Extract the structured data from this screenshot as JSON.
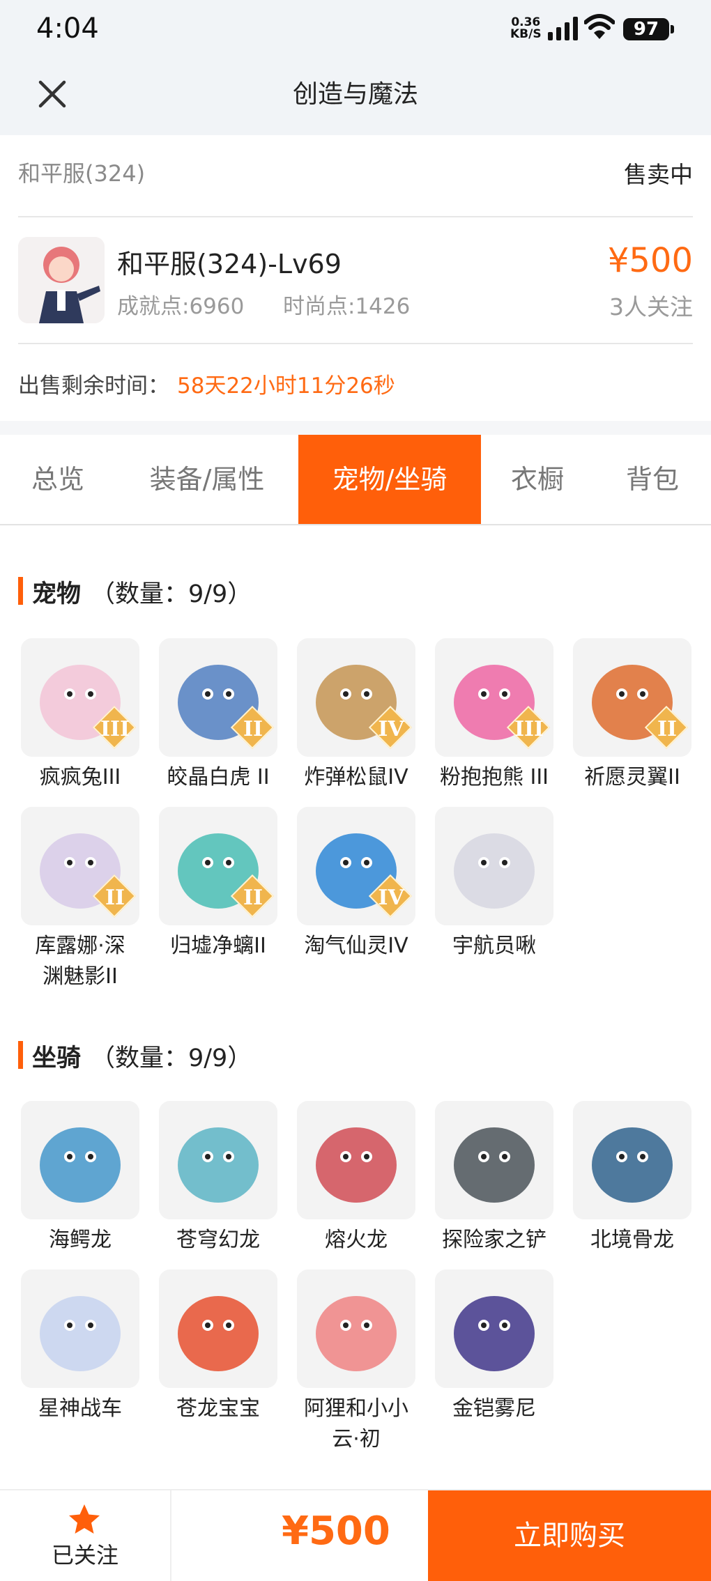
{
  "status_bar": {
    "time": "4:04",
    "net_speed_top": "0.36",
    "net_speed_bottom": "KB/S",
    "battery": "97"
  },
  "nav": {
    "title": "创造与魔法"
  },
  "listing": {
    "server": "和平服(324)",
    "status": "售卖中",
    "character_title": "和平服(324)-Lv69",
    "achievement": "成就点:6960",
    "fashion": "时尚点:1426",
    "price": "¥500",
    "followers": "3人关注",
    "remaining_label": "出售剩余时间：",
    "remaining_value": "58天22小时11分26秒"
  },
  "tabs": [
    {
      "label": "总览",
      "active": false
    },
    {
      "label": "装备/属性",
      "active": false
    },
    {
      "label": "宠物/坐骑",
      "active": true
    },
    {
      "label": "衣橱",
      "active": false
    },
    {
      "label": "背包",
      "active": false
    }
  ],
  "pets": {
    "title": "宠物",
    "count": "（数量：9/9）",
    "items": [
      {
        "name": "疯疯兔III",
        "rank": "III",
        "color": "#f3c6d8"
      },
      {
        "name": "皎晶白虎 II",
        "rank": "II",
        "color": "#5b86c4"
      },
      {
        "name": "炸弹松鼠IV",
        "rank": "IV",
        "color": "#c89a5c"
      },
      {
        "name": "粉抱抱熊 III",
        "rank": "III",
        "color": "#ee6fa9"
      },
      {
        "name": "祈愿灵翼II",
        "rank": "II",
        "color": "#e0743a"
      },
      {
        "name": "库露娜·深\n渊魅影II",
        "rank": "II",
        "color": "#d9cde9"
      },
      {
        "name": "归墟净螭II",
        "rank": "II",
        "color": "#53c1b8"
      },
      {
        "name": "淘气仙灵IV",
        "rank": "IV",
        "color": "#3a8ed8"
      },
      {
        "name": "宇航员啾",
        "rank": "",
        "color": "#d8d8e2"
      }
    ]
  },
  "mounts": {
    "title": "坐骑",
    "count": "（数量：9/9）",
    "items": [
      {
        "name": "海鳄龙",
        "color": "#4f9ccd"
      },
      {
        "name": "苍穹幻龙",
        "color": "#65b8c8"
      },
      {
        "name": "熔火龙",
        "color": "#d3565e"
      },
      {
        "name": "探险家之铲",
        "color": "#555d63"
      },
      {
        "name": "北境骨龙",
        "color": "#3c6b93"
      },
      {
        "name": "星神战车",
        "color": "#c9d5ef"
      },
      {
        "name": "苍龙宝宝",
        "color": "#e85a3b"
      },
      {
        "name": "阿狸和小小\n云·初",
        "color": "#f08a8a"
      },
      {
        "name": "金铠雾尼",
        "color": "#4b4190"
      }
    ]
  },
  "bottom": {
    "follow_label": "已关注",
    "price": "¥500",
    "buy_label": "立即购买"
  },
  "colors": {
    "accent": "#ff5f0a",
    "price": "#ff6a13"
  }
}
